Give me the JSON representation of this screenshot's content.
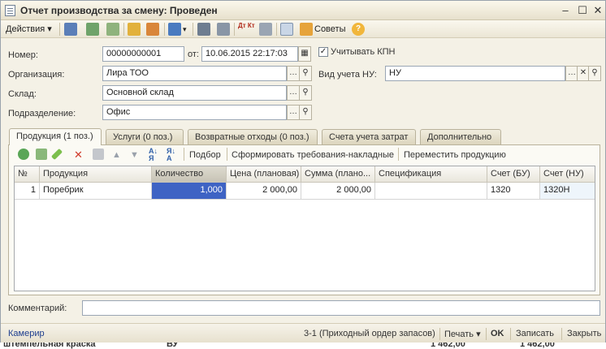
{
  "window": {
    "title": "Отчет производства за смену: Проведен"
  },
  "toolbar": {
    "actions_label": "Действия",
    "tips_label": "Советы",
    "dt_kt": "Дт Кт"
  },
  "form": {
    "number_label": "Номер:",
    "number_value": "00000000001",
    "date_label": "от:",
    "date_value": "10.06.2015 22:17:03",
    "kpn_label": "Учитывать КПН",
    "org_label": "Организация:",
    "org_value": "Лира ТОО",
    "nu_label": "Вид учета НУ:",
    "nu_value": "НУ",
    "warehouse_label": "Склад:",
    "warehouse_value": "Основной склад",
    "division_label": "Подразделение:",
    "division_value": "Офис",
    "comment_label": "Комментарий:",
    "comment_value": ""
  },
  "tabs": [
    {
      "label": "Продукция (1 поз.)"
    },
    {
      "label": "Услуги (0 поз.)"
    },
    {
      "label": "Возвратные отходы (0 поз.)"
    },
    {
      "label": "Счета учета затрат"
    },
    {
      "label": "Дополнительно"
    }
  ],
  "panel_toolbar": {
    "selection_label": "Подбор",
    "generate_label": "Сформировать требования-накладные",
    "move_label": "Переместить продукцию"
  },
  "table": {
    "columns": [
      "№",
      "Продукция",
      "Количество",
      "Цена (плановая)",
      "Сумма (плано...",
      "Спецификация",
      "Счет (БУ)",
      "Счет (НУ)"
    ],
    "rows": [
      {
        "num": "1",
        "product": "Поребрик",
        "qty": "1,000",
        "price": "2 000,00",
        "sum": "2 000,00",
        "spec": "",
        "acc_bu": "1320",
        "acc_nu": "1320Н"
      }
    ]
  },
  "footer": {
    "user": "Камерир",
    "linked_doc": "3-1 (Приходный ордер запасов)",
    "print_label": "Печать",
    "ok_label": "OK",
    "save_label": "Записать",
    "close_label": "Закрыть"
  },
  "background_text": {
    "left": "штемпельная краска",
    "mid": "ВУ",
    "right1": "1 462,00",
    "right2": "1 462,00"
  },
  "colors": {
    "selection": "#3e63c4",
    "window_bg": "#f4f1e6",
    "link": "#1f3f8f"
  }
}
